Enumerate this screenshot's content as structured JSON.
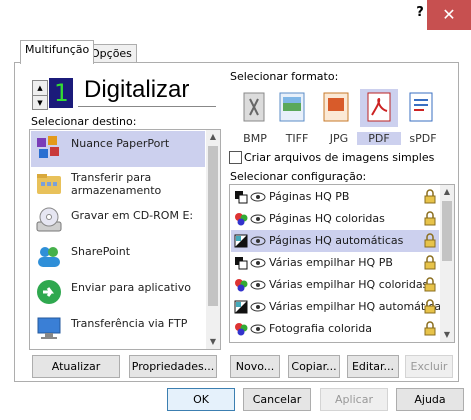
{
  "titlebar": {
    "help_label": "?",
    "close_label": "✕"
  },
  "tabs": [
    {
      "label": "Multifunção"
    },
    {
      "label": "Opções"
    }
  ],
  "scan": {
    "digit": "1",
    "title": "Digitalizar"
  },
  "destinations": {
    "label": "Selecionar destino:",
    "items": [
      {
        "label": "Nuance PaperPort",
        "icon": "paperport-icon"
      },
      {
        "label": "Transferir para armazenamento",
        "icon": "storage-folder-icon"
      },
      {
        "label": "Gravar em CD-ROM  E:",
        "icon": "cd-rom-icon"
      },
      {
        "label": "SharePoint",
        "icon": "sharepoint-icon"
      },
      {
        "label": "Enviar para aplicativo",
        "icon": "send-app-icon"
      },
      {
        "label": "Transferência via FTP",
        "icon": "ftp-icon"
      }
    ]
  },
  "formats": {
    "label": "Selecionar formato:",
    "items": [
      {
        "label": "BMP",
        "icon": "bmp-format-icon"
      },
      {
        "label": "TIFF",
        "icon": "tiff-format-icon"
      },
      {
        "label": "JPG",
        "icon": "jpg-format-icon"
      },
      {
        "label": "PDF",
        "icon": "pdf-format-icon"
      },
      {
        "label": "sPDF",
        "icon": "spdf-format-icon"
      }
    ],
    "checkbox_label": "Criar arquivos de imagens simples"
  },
  "configs": {
    "label": "Selecionar configuração:",
    "items": [
      {
        "label": "Páginas HQ PB",
        "icon": "bw-page-icon"
      },
      {
        "label": "Páginas HQ coloridas",
        "icon": "color-page-icon"
      },
      {
        "label": "Páginas HQ automáticas",
        "icon": "auto-page-icon"
      },
      {
        "label": "Várias empilhar HQ PB",
        "icon": "bw-page-icon"
      },
      {
        "label": "Várias empilhar HQ coloridas",
        "icon": "color-page-icon"
      },
      {
        "label": "Várias empilhar HQ automáticas",
        "icon": "auto-page-icon"
      },
      {
        "label": "Fotografia colorida",
        "icon": "color-page-icon"
      }
    ]
  },
  "buttons": {
    "update": "Atualizar",
    "properties": "Propriedades...",
    "new": "Novo...",
    "copy": "Copiar...",
    "edit": "Editar...",
    "delete": "Excluir",
    "ok": "OK",
    "cancel": "Cancelar",
    "apply": "Aplicar",
    "help": "Ajuda"
  },
  "colors": {
    "selection": "#ccd0ee",
    "close_button": "#c75050",
    "digit_bg": "#1b1b7a",
    "digit_fg": "#33dd33"
  }
}
